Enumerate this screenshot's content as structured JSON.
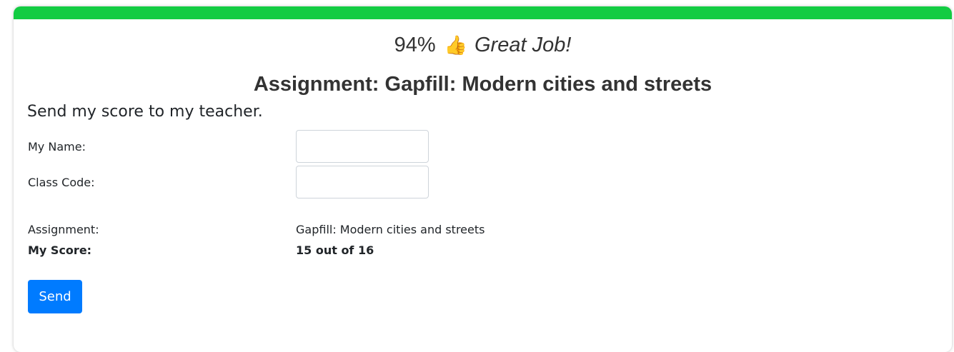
{
  "result": {
    "percent": "94%",
    "thumb_icon": "thumbs-up-icon",
    "thumb_glyph": "👍",
    "praise": "Great Job!"
  },
  "assignment_heading": "Assignment: Gapfill: Modern cities and streets",
  "form": {
    "heading": "Send my score to my teacher.",
    "name_label": "My Name:",
    "name_value": "",
    "class_code_label": "Class Code:",
    "class_code_value": ""
  },
  "summary": {
    "assignment_label": "Assignment:",
    "assignment_value": "Gapfill: Modern cities and streets",
    "score_label": "My Score:",
    "score_value": "15 out of 16"
  },
  "send_button_label": "Send",
  "colors": {
    "top_bar": "#12cc42",
    "button": "#007bff"
  }
}
